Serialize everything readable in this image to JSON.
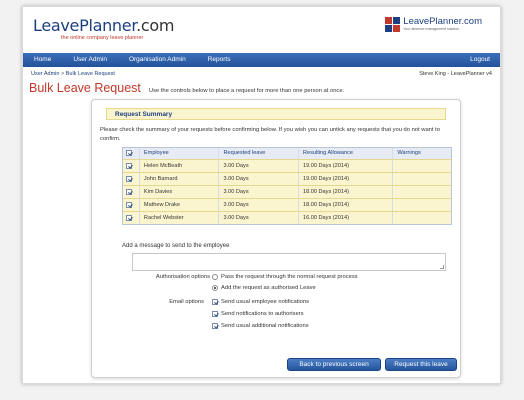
{
  "header": {
    "logo_main": "LeavePlanner",
    "logo_tld": ".com",
    "logo_tagline": "the online company leave planner",
    "right_logo_text": "LeavePlanner.com",
    "right_logo_sub": "Your absence management solution",
    "right_logo_colors": [
      "#c0392b",
      "#1d3f80",
      "#1d3f80",
      "#c0392b"
    ]
  },
  "nav": {
    "items": [
      "Home",
      "User Admin",
      "Organisation Admin",
      "Reports"
    ],
    "logout": "Logout"
  },
  "breadcrumb": {
    "parent": "User Admin",
    "separator": ">",
    "current": "Bulk Leave Request"
  },
  "user_info": "Steve King - LeavePlanner v4",
  "page": {
    "title": "Bulk Leave Request",
    "description": "Use the controls below to place a request for more than one person at once."
  },
  "summary": {
    "heading": "Request Summary",
    "instructions": "Please check the summary of your requests before confirming below. If you wish you can untick any requests that you do not want to confirm.",
    "columns": [
      "Employee",
      "Requested leave",
      "Resulting Allowance",
      "Warnings"
    ],
    "rows": [
      {
        "employee": "Helen McBeath",
        "requested": "3.00 Days",
        "allowance": "19.00 Days (2014)",
        "warnings": ""
      },
      {
        "employee": "John Barnard",
        "requested": "3.00 Days",
        "allowance": "19.00 Days (2014)",
        "warnings": ""
      },
      {
        "employee": "Kim Davies",
        "requested": "3.00 Days",
        "allowance": "18.00 Days (2014)",
        "warnings": ""
      },
      {
        "employee": "Mathew Drake",
        "requested": "3.00 Days",
        "allowance": "18.00 Days (2014)",
        "warnings": ""
      },
      {
        "employee": "Rachel Webster",
        "requested": "3.00 Days",
        "allowance": "16.00 Days (2014)",
        "warnings": ""
      }
    ]
  },
  "message": {
    "label": "Add a message to send to the employee",
    "value": ""
  },
  "authorisation": {
    "label": "Authorisation options",
    "options": [
      "Pass the request through the normal request process",
      "Add the request as authorised Leave"
    ],
    "selected_index": 1
  },
  "email": {
    "label": "Email options",
    "options": [
      "Send usual employee notifications",
      "Send notifications to authorisers",
      "Send usual additional notifications"
    ]
  },
  "buttons": {
    "back": "Back to previous screen",
    "submit": "Request this leave"
  }
}
